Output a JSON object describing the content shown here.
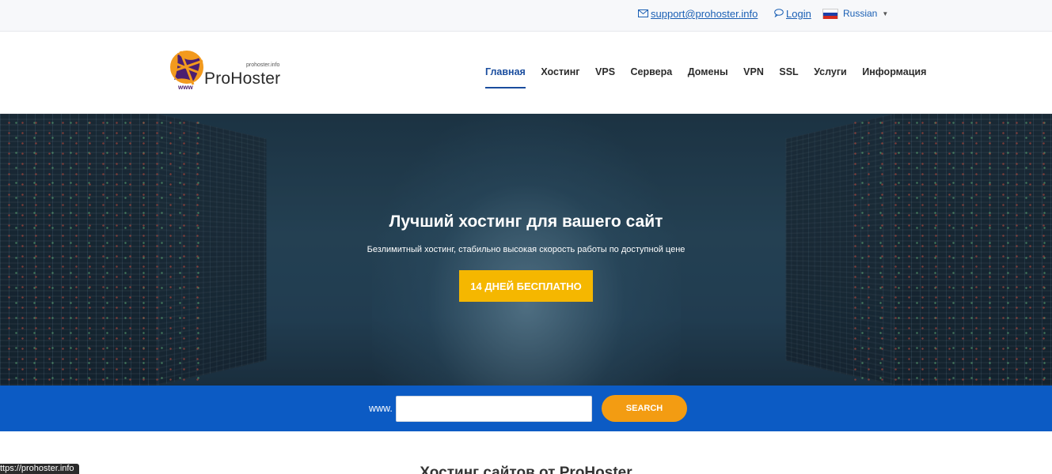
{
  "topbar": {
    "email": "support@prohoster.info",
    "login": "Login",
    "language": "Russian",
    "icons": {
      "email": "envelope-icon",
      "login": "chat-bubble-icon",
      "language": "russia-flag-icon"
    }
  },
  "header": {
    "logo": {
      "domain": "prohoster.info",
      "name": "ProHoster",
      "www": "www"
    },
    "nav": [
      {
        "label": "Главная",
        "active": true
      },
      {
        "label": "Хостинг"
      },
      {
        "label": "VPS"
      },
      {
        "label": "Сервера"
      },
      {
        "label": "Домены"
      },
      {
        "label": "VPN"
      },
      {
        "label": "SSL"
      },
      {
        "label": "Услуги"
      },
      {
        "label": "Информация"
      }
    ]
  },
  "hero": {
    "title": "Лучший хостинг для вашего сайт",
    "subtitle": "Безлимитный хостинг, стабильно высокая скорость работы по доступной цене",
    "cta": "14 ДНЕЙ БЕСПЛАТНО"
  },
  "domain_search": {
    "prefix": "www.",
    "value": "",
    "button": "SEARCH"
  },
  "section": {
    "title": "Хостинг сайтов от ProHoster"
  },
  "statusbar": {
    "url": "ttps://prohoster.info"
  },
  "colors": {
    "accent_blue": "#0c5bc4",
    "nav_active": "#1a4d9e",
    "cta_yellow": "#f5b700",
    "search_orange": "#f39c12"
  }
}
